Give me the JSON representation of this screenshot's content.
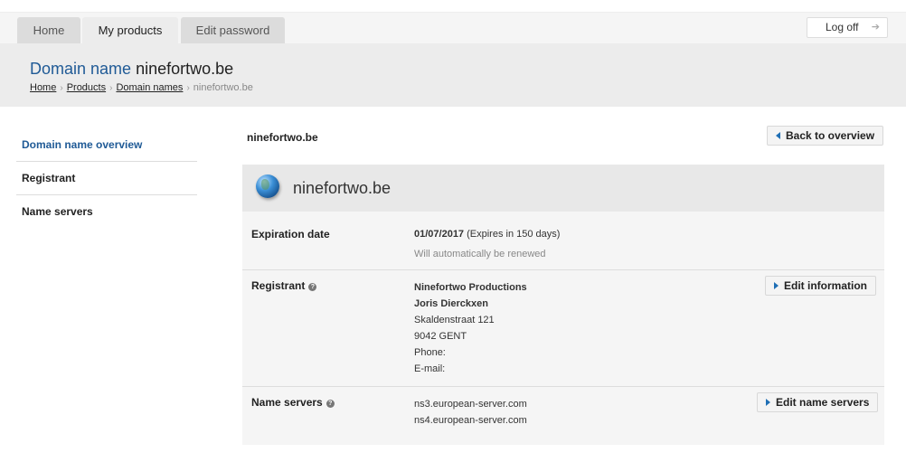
{
  "nav_tabs": [
    {
      "label": "Home"
    },
    {
      "label": "My products"
    },
    {
      "label": "Edit password"
    }
  ],
  "logoff_label": "Log off",
  "header": {
    "title_prefix": "Domain name",
    "title_domain": "ninefortwo.be",
    "breadcrumb": [
      "Home",
      "Products",
      "Domain names",
      "ninefortwo.be"
    ]
  },
  "sidebar": {
    "items": [
      {
        "label": "Domain name overview"
      },
      {
        "label": "Registrant"
      },
      {
        "label": "Name servers"
      }
    ]
  },
  "content": {
    "title": "ninefortwo.be",
    "back_label": "Back to overview",
    "panel_name": "ninefortwo.be",
    "expiration": {
      "label": "Expiration date",
      "date": "01/07/2017",
      "note": "(Expires in 150 days)",
      "renew": "Will automatically be renewed"
    },
    "registrant": {
      "label": "Registrant",
      "company": "Ninefortwo Productions",
      "name": "Joris Dierckxen",
      "street": "Skaldenstraat 121",
      "city": "9042 GENT",
      "phone": "Phone:",
      "email": "E-mail:",
      "edit_label": "Edit information"
    },
    "name_servers": {
      "label": "Name servers",
      "servers": [
        "ns3.european-server.com",
        "ns4.european-server.com"
      ],
      "edit_label": "Edit name servers"
    }
  },
  "colors": {
    "accent_blue": "#1f5a96",
    "button_arrow": "#1f6fb5",
    "header_bg": "#ececec"
  },
  "icons": {
    "domain": "globe-icon",
    "logoff": "arrow-right-icon",
    "help": "help-icon"
  }
}
